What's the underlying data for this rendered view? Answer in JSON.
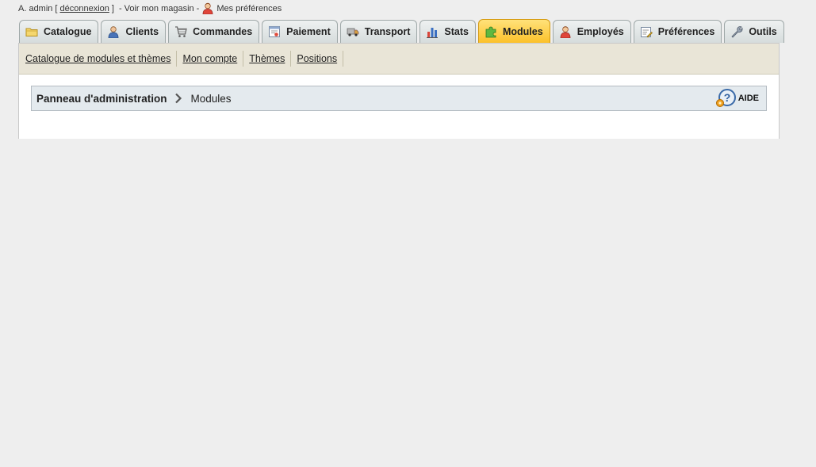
{
  "topbar": {
    "user": "A. admin",
    "bracket_open": "[",
    "logout": "déconnexion",
    "bracket_close": "]",
    "dash1": "-",
    "view_shop": "Voir mon magasin",
    "dash2": "-",
    "my_prefs": "Mes préférences"
  },
  "tabs": [
    {
      "label": "Catalogue",
      "icon": "folder-icon"
    },
    {
      "label": "Clients",
      "icon": "user-icon"
    },
    {
      "label": "Commandes",
      "icon": "cart-icon"
    },
    {
      "label": "Paiement",
      "icon": "payment-icon"
    },
    {
      "label": "Transport",
      "icon": "truck-icon"
    },
    {
      "label": "Stats",
      "icon": "chart-icon"
    },
    {
      "label": "Modules",
      "icon": "puzzle-icon",
      "active": true
    },
    {
      "label": "Employés",
      "icon": "employee-icon"
    },
    {
      "label": "Préférences",
      "icon": "preferences-icon"
    },
    {
      "label": "Outils",
      "icon": "wrench-icon"
    }
  ],
  "subnav": [
    "Catalogue de modules et thèmes",
    "Mon compte",
    "Thèmes",
    "Positions"
  ],
  "breadcrumb": {
    "root": "Panneau d'administration",
    "current": "Modules"
  },
  "help": {
    "label": "AIDE",
    "icon": "help-icon"
  },
  "colors": {
    "active_tab": "#fcc12a",
    "subnav_bg": "#e9e5d7",
    "breadcrumb_bg": "#e4eaee",
    "page_bg": "#eeeeee"
  }
}
